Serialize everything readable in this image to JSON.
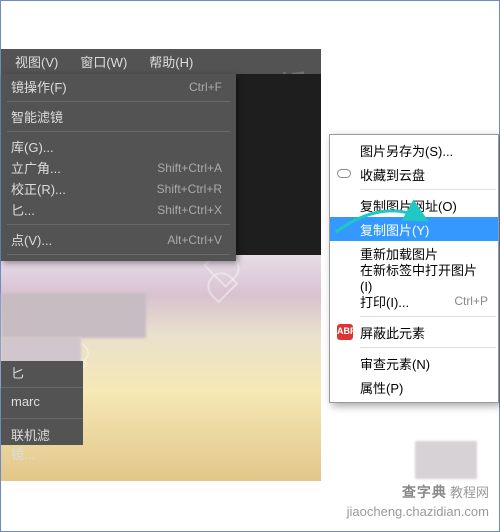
{
  "menubar": {
    "view": "视图(V)",
    "window": "窗口(W)",
    "help": "帮助(H)"
  },
  "faint_wm": "天然呵与你想",
  "left_menu": {
    "filter_last": "镜操作(F)",
    "filter_last_sc": "Ctrl+F",
    "smart_filter": "智能滤镜",
    "gallery": "库(G)...",
    "wide_angle": "立广角...",
    "wide_angle_sc": "Shift+Ctrl+A",
    "correction": "校正(R)...",
    "correction_sc": "Shift+Ctrl+R",
    "liquify": "匕...",
    "liquify_sc": "Shift+Ctrl+X",
    "vanishing": "点(V)...",
    "vanishing_sc": "Alt+Ctrl+V"
  },
  "left_bottom": {
    "a": "匕",
    "b": "marc",
    "c": "联机滤镜..."
  },
  "context": {
    "save_as": "图片另存为(S)...",
    "cloud": "收藏到云盘",
    "copy_url": "复制图片网址(O)",
    "copy_image": "复制图片(Y)",
    "reload": "重新加载图片",
    "open_tab": "在新标签中打开图片(I)",
    "print": "打印(I)...",
    "print_sc": "Ctrl+P",
    "block": "屏蔽此元素",
    "inspect": "审查元素(N)",
    "properties": "属性(P)"
  },
  "watermark": {
    "brand": "查字典",
    "sub": "教程网",
    "url": "jiaocheng.chazidian.com"
  }
}
